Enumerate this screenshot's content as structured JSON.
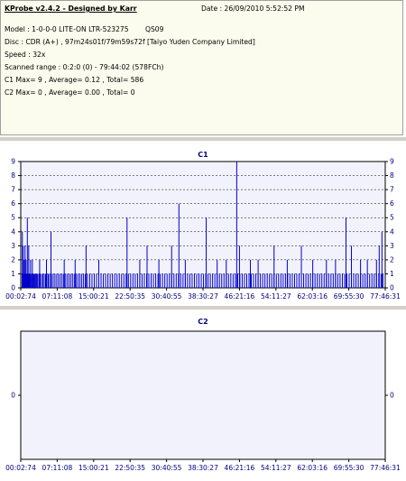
{
  "info": {
    "title": "KProbe v2.4.2 - Designed by Karr",
    "date": "Date : 26/09/2010 5:52:52 PM",
    "model": "Model : 1-0-0-0 LITE-ON LTR-523275",
    "model_code": "QS09",
    "disc": "Disc : CDR (A+) , 97m24s01f/79m59s72f [Taiyo Yuden Company Limited]",
    "speed": "Speed : 32x",
    "scanned_range": "Scanned range : 0:2:0 (0) - 79:44:02 (578FCh)",
    "c1_stats": "C1 Max= 9 , Average= 0.12 , Total= 586",
    "c2_stats": "C2 Max= 0 , Average= 0.00 , Total= 0"
  },
  "colors": {
    "bar": "#0000cc",
    "plot_bg": "#f2f2fc",
    "grid": "#000000",
    "label": "#000080"
  },
  "chart_data": [
    {
      "type": "bar",
      "title": "C1",
      "ylim": [
        0,
        9
      ],
      "yticks": [
        "0",
        "1",
        "2",
        "3",
        "4",
        "5",
        "6",
        "7",
        "8",
        "9"
      ],
      "xticks": [
        "00:02:74",
        "07:11:08",
        "15:00:21",
        "22:50:35",
        "30:40:55",
        "38:30:27",
        "46:21:16",
        "54:11:27",
        "62:03:16",
        "69:55:30",
        "77:46:31"
      ],
      "grid": true,
      "x_range_minutes": [
        0.05,
        79.73
      ],
      "baseline_spikes": [
        0.15,
        0.3,
        0.45,
        0.6,
        0.75,
        0.9,
        1.05,
        1.2,
        1.35,
        1.5,
        1.65,
        1.8,
        1.95,
        2.1,
        2.3,
        2.5,
        2.7,
        2.9,
        3.1,
        3.3,
        3.5,
        3.8,
        4.1,
        4.4,
        4.7,
        5.0,
        5.3,
        5.6,
        5.9,
        6.2,
        6.5,
        6.8,
        7.2,
        7.6,
        8.0,
        8.4,
        8.8,
        9.2,
        9.6,
        10.0,
        10.4,
        10.8,
        11.2,
        11.6,
        12.0,
        12.4,
        12.8,
        13.2,
        13.6,
        14.0,
        14.5,
        15.0,
        15.5,
        16.0,
        16.5,
        17.0,
        17.5,
        18.0,
        18.5,
        19.0,
        19.5,
        20.0,
        20.5,
        21.0,
        21.5,
        22.0,
        22.5,
        23.0,
        23.5,
        24.0,
        24.5,
        25.0,
        25.5,
        26.0,
        26.5,
        27.0,
        27.5,
        28.0,
        28.5,
        29.0,
        29.5,
        30.0,
        30.5,
        31.0,
        31.5,
        32.0,
        32.5,
        33.0,
        33.5,
        34.0,
        34.5,
        35.0,
        35.5,
        36.0,
        36.5,
        37.0,
        37.5,
        38.0,
        38.5,
        39.0,
        39.5,
        40.0,
        40.5,
        41.0,
        41.5,
        42.0,
        42.5,
        43.0,
        43.5,
        44.0,
        44.5,
        45.0,
        45.5,
        46.0,
        46.5,
        47.0,
        47.5,
        48.0,
        48.5,
        49.0,
        49.5,
        50.0,
        50.5,
        51.0,
        51.5,
        52.0,
        52.5,
        53.0,
        53.5,
        54.0,
        54.5,
        55.0,
        55.5,
        56.0,
        56.5,
        57.0,
        57.5,
        58.0,
        58.5,
        59.0,
        59.5,
        60.0,
        60.5,
        61.0,
        61.5,
        62.0,
        62.5,
        63.0,
        63.5,
        64.0,
        64.5,
        65.0,
        65.5,
        66.0,
        66.5,
        67.0,
        67.5,
        68.0,
        68.5,
        69.0,
        69.5,
        70.0,
        70.5,
        71.0,
        71.5,
        72.0,
        72.5,
        73.0,
        73.5,
        74.0,
        74.5,
        75.0,
        75.5,
        76.0,
        76.5,
        77.0,
        77.5,
        78.0,
        78.5,
        79.0,
        79.4
      ],
      "spikes": [
        {
          "x": 0.2,
          "y": 4
        },
        {
          "x": 0.4,
          "y": 3
        },
        {
          "x": 0.6,
          "y": 2
        },
        {
          "x": 0.8,
          "y": 3
        },
        {
          "x": 1.0,
          "y": 2
        },
        {
          "x": 1.3,
          "y": 5
        },
        {
          "x": 1.6,
          "y": 3
        },
        {
          "x": 2.0,
          "y": 2
        },
        {
          "x": 2.4,
          "y": 2
        },
        {
          "x": 2.8,
          "y": 1
        },
        {
          "x": 4.0,
          "y": 2
        },
        {
          "x": 5.5,
          "y": 2
        },
        {
          "x": 6.5,
          "y": 4
        },
        {
          "x": 9.4,
          "y": 2
        },
        {
          "x": 11.8,
          "y": 2
        },
        {
          "x": 14.2,
          "y": 3
        },
        {
          "x": 17.0,
          "y": 2
        },
        {
          "x": 23.2,
          "y": 5
        },
        {
          "x": 26.0,
          "y": 2
        },
        {
          "x": 27.6,
          "y": 3
        },
        {
          "x": 30.2,
          "y": 2
        },
        {
          "x": 33.0,
          "y": 3
        },
        {
          "x": 34.6,
          "y": 6
        },
        {
          "x": 36.0,
          "y": 2
        },
        {
          "x": 40.6,
          "y": 5
        },
        {
          "x": 43.0,
          "y": 2
        },
        {
          "x": 45.0,
          "y": 2
        },
        {
          "x": 47.3,
          "y": 9
        },
        {
          "x": 47.9,
          "y": 3
        },
        {
          "x": 50.3,
          "y": 2
        },
        {
          "x": 52.0,
          "y": 2
        },
        {
          "x": 55.5,
          "y": 3
        },
        {
          "x": 58.4,
          "y": 2
        },
        {
          "x": 61.5,
          "y": 3
        },
        {
          "x": 64.0,
          "y": 2
        },
        {
          "x": 67.0,
          "y": 2
        },
        {
          "x": 69.0,
          "y": 2
        },
        {
          "x": 71.3,
          "y": 5
        },
        {
          "x": 72.5,
          "y": 3
        },
        {
          "x": 74.5,
          "y": 2
        },
        {
          "x": 76.0,
          "y": 2
        },
        {
          "x": 78.0,
          "y": 2
        },
        {
          "x": 78.6,
          "y": 3
        },
        {
          "x": 79.2,
          "y": 4
        }
      ]
    },
    {
      "type": "bar",
      "title": "C2",
      "ylim": [
        0,
        0
      ],
      "yticks": [
        "0"
      ],
      "xticks": [
        "00:02:74",
        "07:11:08",
        "15:00:21",
        "22:50:35",
        "30:40:55",
        "38:30:27",
        "46:21:16",
        "54:11:27",
        "62:03:16",
        "69:55:30",
        "77:46:31"
      ],
      "grid": false,
      "values": []
    }
  ]
}
